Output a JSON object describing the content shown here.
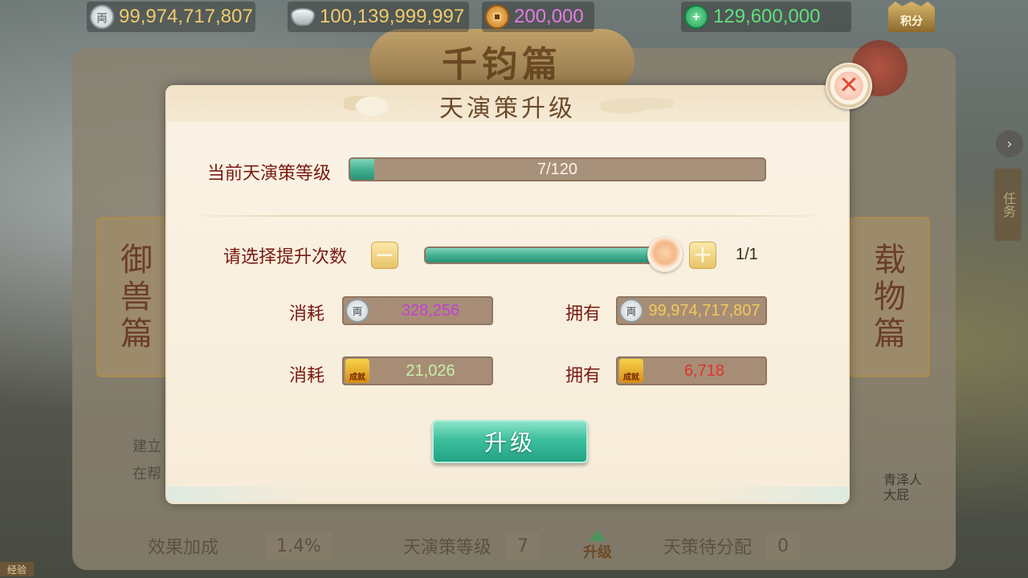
{
  "resources": {
    "silver": "99,974,717,807",
    "ingot": "100,139,999,997",
    "copper": "200,000",
    "jade": "129,600,000",
    "jifen_label": "积分"
  },
  "background": {
    "plaque": "千钧篇",
    "left_side": [
      "御",
      "兽",
      "篇"
    ],
    "right_side": [
      "载",
      "物",
      "篇"
    ],
    "task_tab": "任务",
    "bottom_labels": [
      "效果加成",
      "1.4%",
      "天演策等级",
      "7",
      "升级",
      "天策待分配",
      "0"
    ],
    "corner_badge": "经验",
    "right_note": "青泽人\n大屁",
    "left_note": "建立\n在帮"
  },
  "dialog": {
    "title": "天演策升级",
    "level_label": "当前天演策等级",
    "level_text": "7/120",
    "level_progress": 0.0583,
    "select_label": "请选择提升次数",
    "select_count": "1/1",
    "slider_fraction": 1.0,
    "minus_label": "−",
    "plus_label": "+",
    "rows": [
      {
        "cost_label": "消耗",
        "cost_value": "328,256",
        "cost_icon": "silver-coin-icon",
        "cost_color": "#c23fd6",
        "own_label": "拥有",
        "own_value": "99,974,717,807",
        "own_icon": "silver-coin-icon",
        "own_color": "#f1c95a"
      },
      {
        "cost_label": "消耗",
        "cost_value": "21,026",
        "cost_icon": "achievement-icon",
        "cost_color": "#c5f2a8",
        "own_label": "拥有",
        "own_value": "6,718",
        "own_icon": "achievement-icon",
        "own_color": "#e0322a"
      }
    ],
    "upgrade_button": "升级"
  },
  "colors": {
    "silver_text": "#f0cc6b",
    "ingot_text": "#f0cc6b",
    "copper_text": "#e37be0",
    "jade_text": "#5ee27c"
  }
}
